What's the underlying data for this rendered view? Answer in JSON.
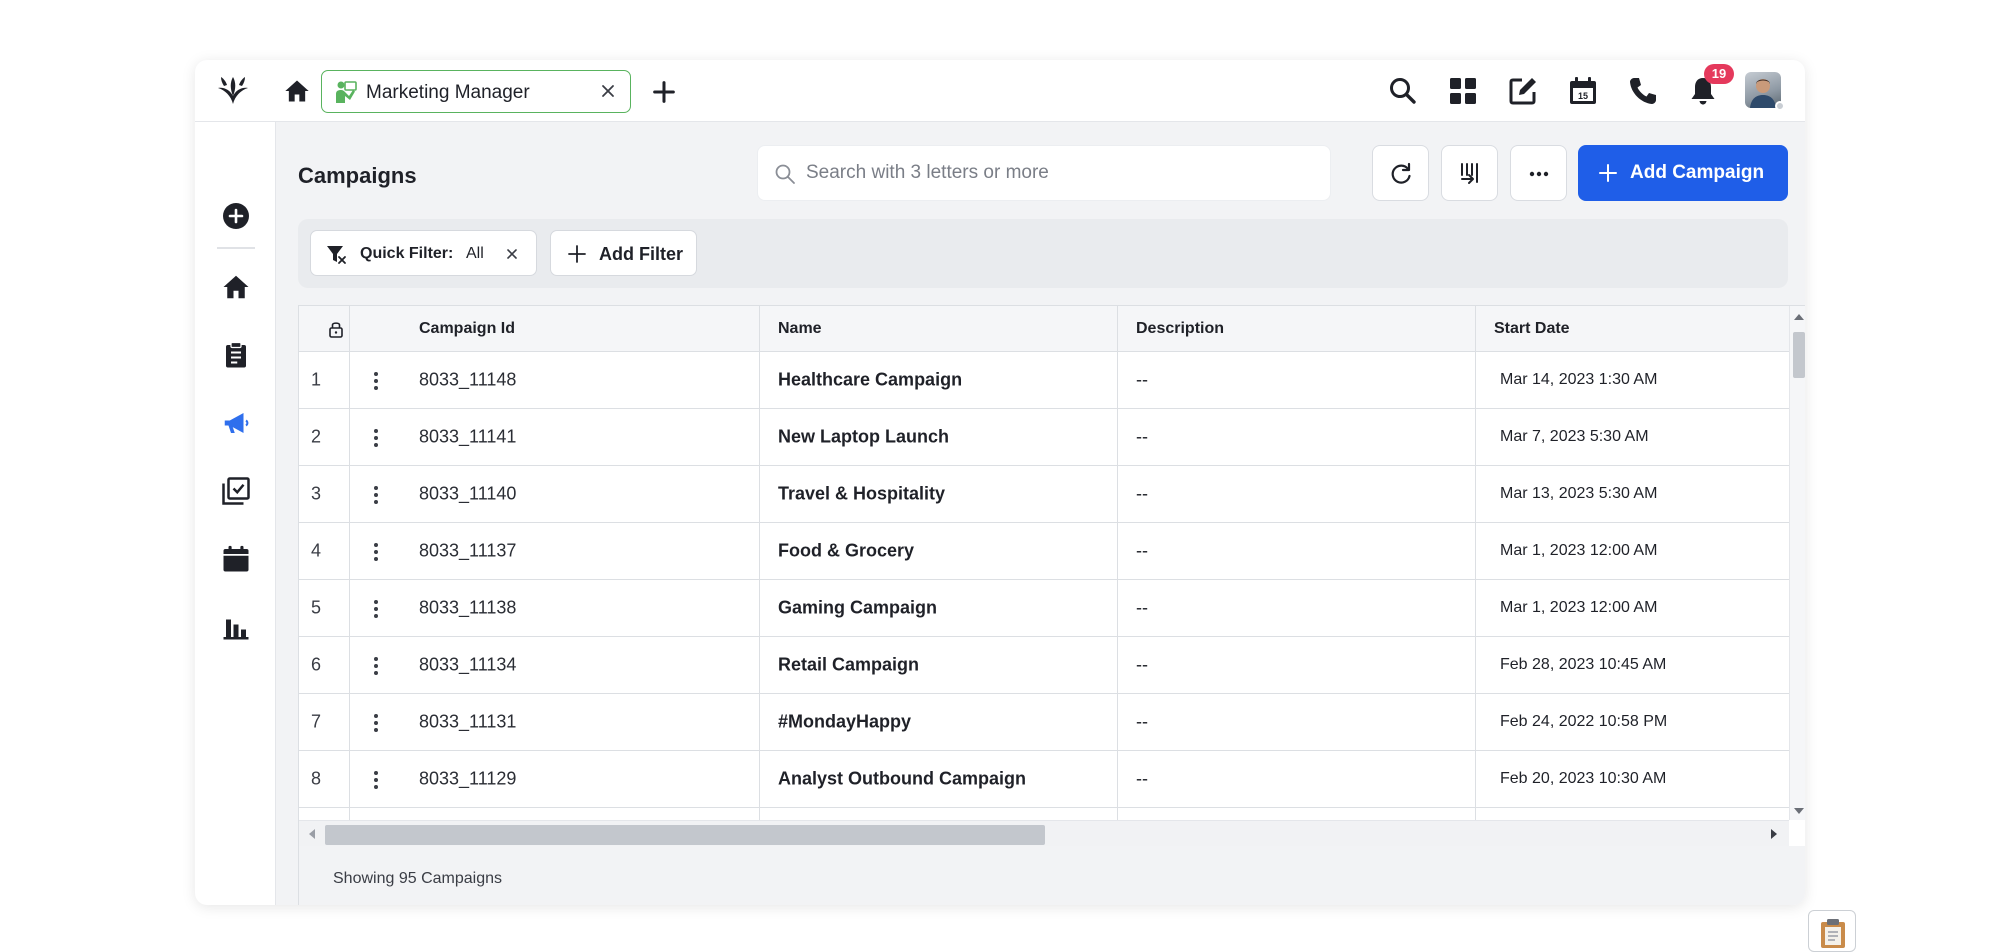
{
  "topbar": {
    "tab_label": "Marketing Manager",
    "notification_count": "19"
  },
  "page": {
    "title": "Campaigns"
  },
  "search": {
    "placeholder": "Search with 3 letters or more"
  },
  "actions": {
    "add_campaign_label": "Add Campaign"
  },
  "filters": {
    "quick_filter_label": "Quick Filter:",
    "quick_filter_value": "All",
    "add_filter_label": "Add Filter"
  },
  "table": {
    "columns": [
      "Campaign Id",
      "Name",
      "Description",
      "Start Date"
    ],
    "rows": [
      {
        "index": "1",
        "id": "8033_11148",
        "name": "Healthcare Campaign",
        "description": "--",
        "start_date": "Mar 14, 2023 1:30 AM"
      },
      {
        "index": "2",
        "id": "8033_11141",
        "name": "New Laptop Launch",
        "description": "--",
        "start_date": "Mar 7, 2023 5:30 AM"
      },
      {
        "index": "3",
        "id": "8033_11140",
        "name": "Travel & Hospitality",
        "description": "--",
        "start_date": "Mar 13, 2023 5:30 AM"
      },
      {
        "index": "4",
        "id": "8033_11137",
        "name": "Food & Grocery",
        "description": "--",
        "start_date": "Mar 1, 2023 12:00 AM"
      },
      {
        "index": "5",
        "id": "8033_11138",
        "name": "Gaming Campaign",
        "description": "--",
        "start_date": "Mar 1, 2023 12:00 AM"
      },
      {
        "index": "6",
        "id": "8033_11134",
        "name": "Retail Campaign",
        "description": "--",
        "start_date": "Feb 28, 2023 10:45 AM"
      },
      {
        "index": "7",
        "id": "8033_11131",
        "name": "#MondayHappy",
        "description": "--",
        "start_date": "Feb 24, 2022 10:58 PM"
      },
      {
        "index": "8",
        "id": "8033_11129",
        "name": "Analyst Outbound Campaign",
        "description": "--",
        "start_date": "Feb 20, 2023 10:30 AM"
      }
    ]
  },
  "footer": {
    "summary": "Showing 95 Campaigns"
  },
  "colors": {
    "primary": "#1f5ee8",
    "tab_border": "#59b35e",
    "badge": "#e5395c",
    "active_nav": "#2f6fed"
  }
}
